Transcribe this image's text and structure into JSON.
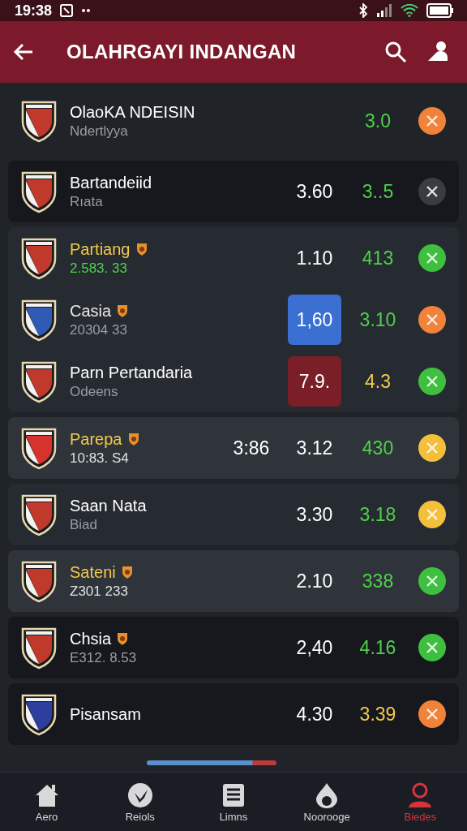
{
  "status_bar": {
    "time": "19:38"
  },
  "header": {
    "title": "OLAHRGAYI INDANGAN"
  },
  "groups": [
    {
      "kind": "none",
      "rows": [
        {
          "name": {
            "text": "OlaoKA NDEISIN",
            "color": "#ffffff"
          },
          "badge": false,
          "sub": {
            "text": "Ndertlyya",
            "color": "#9a9da4"
          },
          "odds": [
            {
              "value": "3.0",
              "color": "#4fd14a"
            }
          ],
          "action": {
            "color": "#f0823a"
          }
        }
      ]
    },
    {
      "kind": "dark",
      "rows": [
        {
          "name": {
            "text": "Bartandeiid",
            "color": "#ffffff"
          },
          "badge": false,
          "sub": {
            "text": "Rıata",
            "color": "#9a9da4"
          },
          "odds": [
            {
              "value": "3.60",
              "color": "#ffffff"
            },
            {
              "value": "3..5",
              "color": "#4fd14a"
            }
          ],
          "action": {
            "color": "#3a3c42"
          }
        }
      ]
    },
    {
      "kind": "mid",
      "rows": [
        {
          "name": {
            "text": "Partiang",
            "color": "#f2c94c"
          },
          "badge": true,
          "sub": {
            "text": "2.583. 33",
            "color": "#4fd14a"
          },
          "odds": [
            {
              "value": "1.10",
              "color": "#ffffff"
            },
            {
              "value": "413",
              "color": "#4fd14a"
            }
          ],
          "action": {
            "color": "#3fbf3f"
          }
        },
        {
          "name": {
            "text": "Casia",
            "color": "#e8e8e8"
          },
          "badge": true,
          "sub": {
            "text": "20304  33",
            "color": "#9a9da4"
          },
          "odds": [
            {
              "value": "1,60",
              "color": "#ffffff",
              "highlight": {
                "color": "#3b6fd1"
              }
            },
            {
              "value": "3.10",
              "color": "#4fd14a"
            }
          ],
          "action": {
            "color": "#f0823a"
          }
        },
        {
          "name": {
            "text": "Parn Pertandaria",
            "color": "#ffffff"
          },
          "badge": false,
          "sub": {
            "text": "Odeens",
            "color": "#9a9da4"
          },
          "odds": [
            {
              "value": "7.9.",
              "color": "#ffffff",
              "highlight": {
                "color": "#7a1e28"
              }
            },
            {
              "value": "4.3",
              "color": "#f2c94c"
            }
          ],
          "action": {
            "color": "#3fbf3f"
          }
        }
      ]
    },
    {
      "kind": "light",
      "rows": [
        {
          "name": {
            "text": "Parepa",
            "color": "#f2c94c"
          },
          "badge": true,
          "sub": {
            "text": "10:83. S4",
            "color": "#e0e0e0"
          },
          "odds": [
            {
              "value": "3:86",
              "color": "#ffffff"
            },
            {
              "value": "3.12",
              "color": "#ffffff"
            },
            {
              "value": "430",
              "color": "#4fd14a"
            }
          ],
          "action": {
            "color": "#f4c03c"
          }
        }
      ]
    },
    {
      "kind": "mid",
      "rows": [
        {
          "name": {
            "text": "Saan Nata",
            "color": "#ffffff"
          },
          "badge": false,
          "sub": {
            "text": "Biad",
            "color": "#9a9da4"
          },
          "odds": [
            {
              "value": "3.30",
              "color": "#ffffff"
            },
            {
              "value": "3.18",
              "color": "#4fd14a"
            }
          ],
          "action": {
            "color": "#f4c03c"
          }
        }
      ]
    },
    {
      "kind": "light",
      "rows": [
        {
          "name": {
            "text": "Sateni",
            "color": "#f2c94c"
          },
          "badge": true,
          "sub": {
            "text": "Z301 233",
            "color": "#e0e0e0"
          },
          "odds": [
            {
              "value": "2.10",
              "color": "#ffffff"
            },
            {
              "value": "338",
              "color": "#4fd14a"
            }
          ],
          "action": {
            "color": "#3fbf3f"
          }
        }
      ]
    },
    {
      "kind": "dark",
      "rows": [
        {
          "name": {
            "text": "Chsia",
            "color": "#ffffff"
          },
          "badge": true,
          "sub": {
            "text": "E312. 8.53",
            "color": "#9a9da4"
          },
          "odds": [
            {
              "value": "2,40",
              "color": "#ffffff"
            },
            {
              "value": "4.16",
              "color": "#4fd14a"
            }
          ],
          "action": {
            "color": "#3fbf3f"
          }
        }
      ]
    },
    {
      "kind": "dark",
      "rows": [
        {
          "name": {
            "text": "Pisansam",
            "color": "#ffffff"
          },
          "badge": false,
          "odds": [
            {
              "value": "4.30",
              "color": "#ffffff"
            },
            {
              "value": "3.39",
              "color": "#f2c94c"
            }
          ],
          "action": {
            "color": "#f0823a"
          }
        }
      ]
    }
  ],
  "nav": [
    {
      "label": "Aero",
      "selected": false
    },
    {
      "label": "Reiols",
      "selected": false
    },
    {
      "label": "Limns",
      "selected": false
    },
    {
      "label": "Noorooge",
      "selected": false
    },
    {
      "label": "Biedes",
      "selected": true
    }
  ]
}
